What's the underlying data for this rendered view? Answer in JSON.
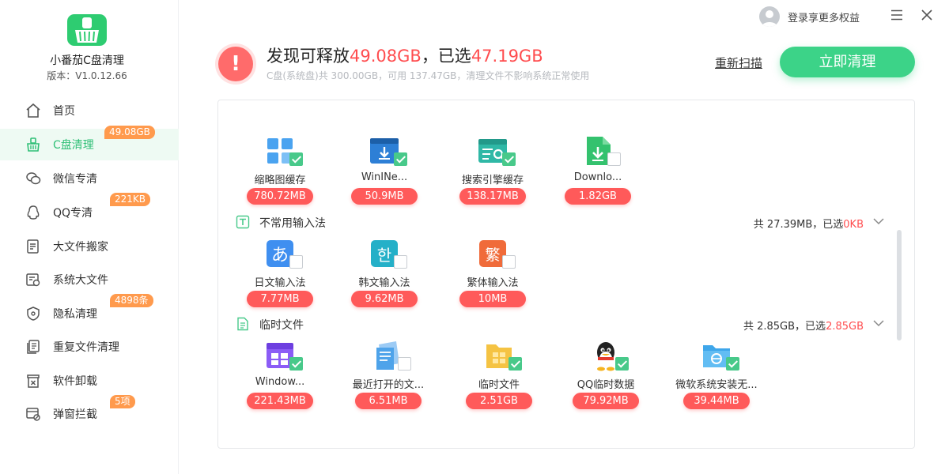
{
  "app": {
    "name": "小番茄C盘清理",
    "version": "版本：V1.0.12.66"
  },
  "topbar": {
    "user_label": "登录享更多权益"
  },
  "nav": [
    {
      "label": "首页",
      "icon": "home-icon",
      "badge": ""
    },
    {
      "label": "C盘清理",
      "icon": "broom-icon",
      "badge": "49.08GB",
      "active": true
    },
    {
      "label": "微信专清",
      "icon": "wechat-icon",
      "badge": ""
    },
    {
      "label": "QQ专清",
      "icon": "qq-icon",
      "badge": "221KB"
    },
    {
      "label": "大文件搬家",
      "icon": "file-move-icon",
      "badge": ""
    },
    {
      "label": "系统大文件",
      "icon": "system-file-icon",
      "badge": ""
    },
    {
      "label": "隐私清理",
      "icon": "shield-icon",
      "badge": "4898条"
    },
    {
      "label": "重复文件清理",
      "icon": "duplicate-file-icon",
      "badge": ""
    },
    {
      "label": "软件卸载",
      "icon": "uninstall-icon",
      "badge": ""
    },
    {
      "label": "弹窗拦截",
      "icon": "popup-block-icon",
      "badge": "5项"
    }
  ],
  "summary": {
    "prefix": "发现可释放",
    "free_size": "49.08GB",
    "mid": "，已选",
    "selected_size": "47.19GB",
    "subtitle": "C盘(系统盘)共 300.00GB，可用 137.47GB，清理文件不影响系统正常使用",
    "rescan_label": "重新扫描",
    "clean_label": "立即清理"
  },
  "sections": [
    {
      "title": "",
      "items": [
        {
          "name": "缩略图缓存",
          "size": "780.72MB",
          "checked": true,
          "icon": "thumbnail-grid-icon"
        },
        {
          "name": "WinINe...",
          "size": "50.9MB",
          "checked": true,
          "icon": "browser-download-icon"
        },
        {
          "name": "搜索引擎缓存",
          "size": "138.17MB",
          "checked": true,
          "icon": "search-engine-icon"
        },
        {
          "name": "Downlo...",
          "size": "1.82GB",
          "checked": false,
          "icon": "download-file-icon"
        }
      ]
    },
    {
      "title": "不常用输入法",
      "summary_prefix": "共 27.39MB，已选",
      "summary_selected": "0KB",
      "items": [
        {
          "name": "日文输入法",
          "size": "7.77MB",
          "checked": false,
          "icon": "japanese-ime-icon",
          "glyph": "あ"
        },
        {
          "name": "韩文输入法",
          "size": "9.62MB",
          "checked": false,
          "icon": "korean-ime-icon",
          "glyph": "한"
        },
        {
          "name": "繁体输入法",
          "size": "10MB",
          "checked": false,
          "icon": "traditional-ime-icon",
          "glyph": "繁"
        }
      ]
    },
    {
      "title": "临时文件",
      "summary_prefix": "共 2.85GB，已选",
      "summary_selected": "2.85GB",
      "items": [
        {
          "name": "Window...",
          "size": "221.43MB",
          "checked": true,
          "icon": "windows-window-icon"
        },
        {
          "name": "最近打开的文...",
          "size": "6.51MB",
          "checked": false,
          "icon": "recent-docs-icon"
        },
        {
          "name": "临时文件",
          "size": "2.51GB",
          "checked": true,
          "icon": "temp-folder-icon"
        },
        {
          "name": "QQ临时数据",
          "size": "79.92MB",
          "checked": true,
          "icon": "qq-penguin-icon"
        },
        {
          "name": "微软系统安装无...",
          "size": "39.44MB",
          "checked": true,
          "icon": "ms-install-folder-icon"
        }
      ]
    }
  ],
  "colors": {
    "accent": "#3cd388",
    "danger": "#ff5a5a",
    "badge": "#ff9a4d"
  }
}
